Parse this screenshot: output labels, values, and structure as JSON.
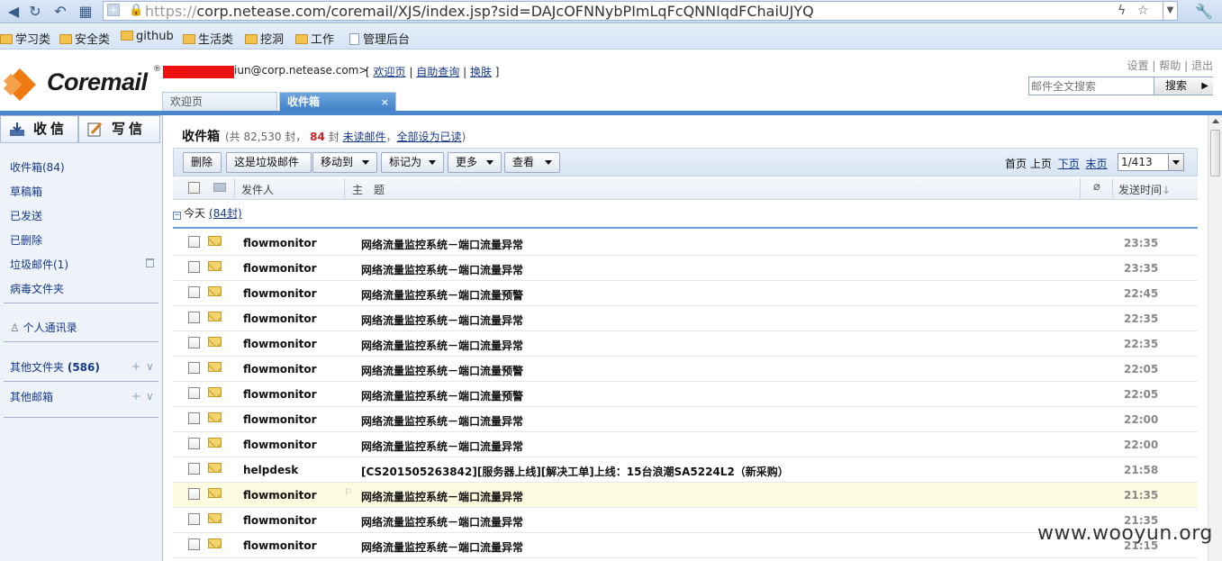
{
  "browser": {
    "url_protocol": "https://",
    "url_rest": "corp.netease.com/coremail/XJS/index.jsp?sid=DAJcOFNNybPImLqFcQNNIqdFChaiUJYQ"
  },
  "bookmarks": [
    {
      "label": "学习类"
    },
    {
      "label": "安全类"
    },
    {
      "label": "github"
    },
    {
      "label": "生活类"
    },
    {
      "label": "挖洞"
    },
    {
      "label": "工作"
    },
    {
      "label": "管理后台"
    }
  ],
  "header": {
    "logo_text": "Coremail",
    "logo_reg": "®",
    "user_email": "iun@corp.netease.com>",
    "bracket_open": "[",
    "bracket_close": "]",
    "sep": "|",
    "link_welcome": "欢迎页",
    "link_self_query": "自助查询",
    "link_change_skin": "换肤",
    "top_settings": "设置",
    "top_help": "帮助",
    "top_logout": "退出",
    "search_placeholder": "邮件全文搜索",
    "search_button": "搜索"
  },
  "tabs": {
    "welcome": "欢迎页",
    "inbox": "收件箱",
    "close": "×"
  },
  "sidebar": {
    "receive_button": "收信",
    "write_button": "写信",
    "inbox": "收件箱(84)",
    "drafts": "草稿箱",
    "sent": "已发送",
    "deleted": "已删除",
    "spam": "垃圾邮件(1)",
    "virus": "病毒文件夹",
    "contacts": "个人通讯录",
    "other_folders": "其他文件夹",
    "other_folders_count": "(586)",
    "other_mailboxes": "其他邮箱",
    "plus": "+",
    "chevron": "∨"
  },
  "main": {
    "title": "收件箱",
    "stats_prefix": "(共 82,530 封，",
    "unread_count": "84",
    "stats_mid": "封",
    "unread_link": "未读邮件",
    "comma": "，",
    "mark_all_read": "全部设为已读",
    "stats_suffix": ")",
    "toolbar": {
      "delete": "删除",
      "spam": "这是垃圾邮件",
      "move_to": "移动到",
      "mark_as": "标记为",
      "more": "更多",
      "view": "查看"
    },
    "pager": {
      "first": "首页",
      "prev": "上页",
      "next": "下页",
      "last": "末页",
      "page_value": "1/413"
    },
    "columns": {
      "sender": "发件人",
      "subject": "主　题",
      "clip": "⌀",
      "time": "发送时间",
      "sort_arrow": "↓"
    },
    "group_label": "今天",
    "group_count": "(84封)",
    "emails": [
      {
        "sender": "flowmonitor",
        "subject": "网络流量监控系统－端口流量异常",
        "time": "23:35"
      },
      {
        "sender": "flowmonitor",
        "subject": "网络流量监控系统－端口流量异常",
        "time": "23:35"
      },
      {
        "sender": "flowmonitor",
        "subject": "网络流量监控系统－端口流量预警",
        "time": "22:45"
      },
      {
        "sender": "flowmonitor",
        "subject": "网络流量监控系统－端口流量异常",
        "time": "22:35"
      },
      {
        "sender": "flowmonitor",
        "subject": "网络流量监控系统－端口流量异常",
        "time": "22:35"
      },
      {
        "sender": "flowmonitor",
        "subject": "网络流量监控系统－端口流量预警",
        "time": "22:05"
      },
      {
        "sender": "flowmonitor",
        "subject": "网络流量监控系统－端口流量预警",
        "time": "22:05"
      },
      {
        "sender": "flowmonitor",
        "subject": "网络流量监控系统－端口流量异常",
        "time": "22:00"
      },
      {
        "sender": "flowmonitor",
        "subject": "网络流量监控系统－端口流量异常",
        "time": "22:00"
      },
      {
        "sender": "helpdesk",
        "subject": "[CS201505263842][服务器上线][解决工单]上线：15台浪潮SA5224L2（新采购）",
        "time": "21:58"
      },
      {
        "sender": "flowmonitor",
        "subject": "网络流量监控系统－端口流量异常",
        "time": "21:35",
        "highlighted": true
      },
      {
        "sender": "flowmonitor",
        "subject": "网络流量监控系统－端口流量异常",
        "time": "21:35"
      },
      {
        "sender": "flowmonitor",
        "subject": "网络流量监控系统－端口流量异常",
        "time": "21:15"
      }
    ]
  },
  "watermark": "www.wooyun.org",
  "colors": {
    "accent_blue": "#4a86cc",
    "link_blue": "#15388a",
    "unread_red": "#d12020",
    "redaction": "#ee1111",
    "logo_orange": "#f07a12"
  }
}
